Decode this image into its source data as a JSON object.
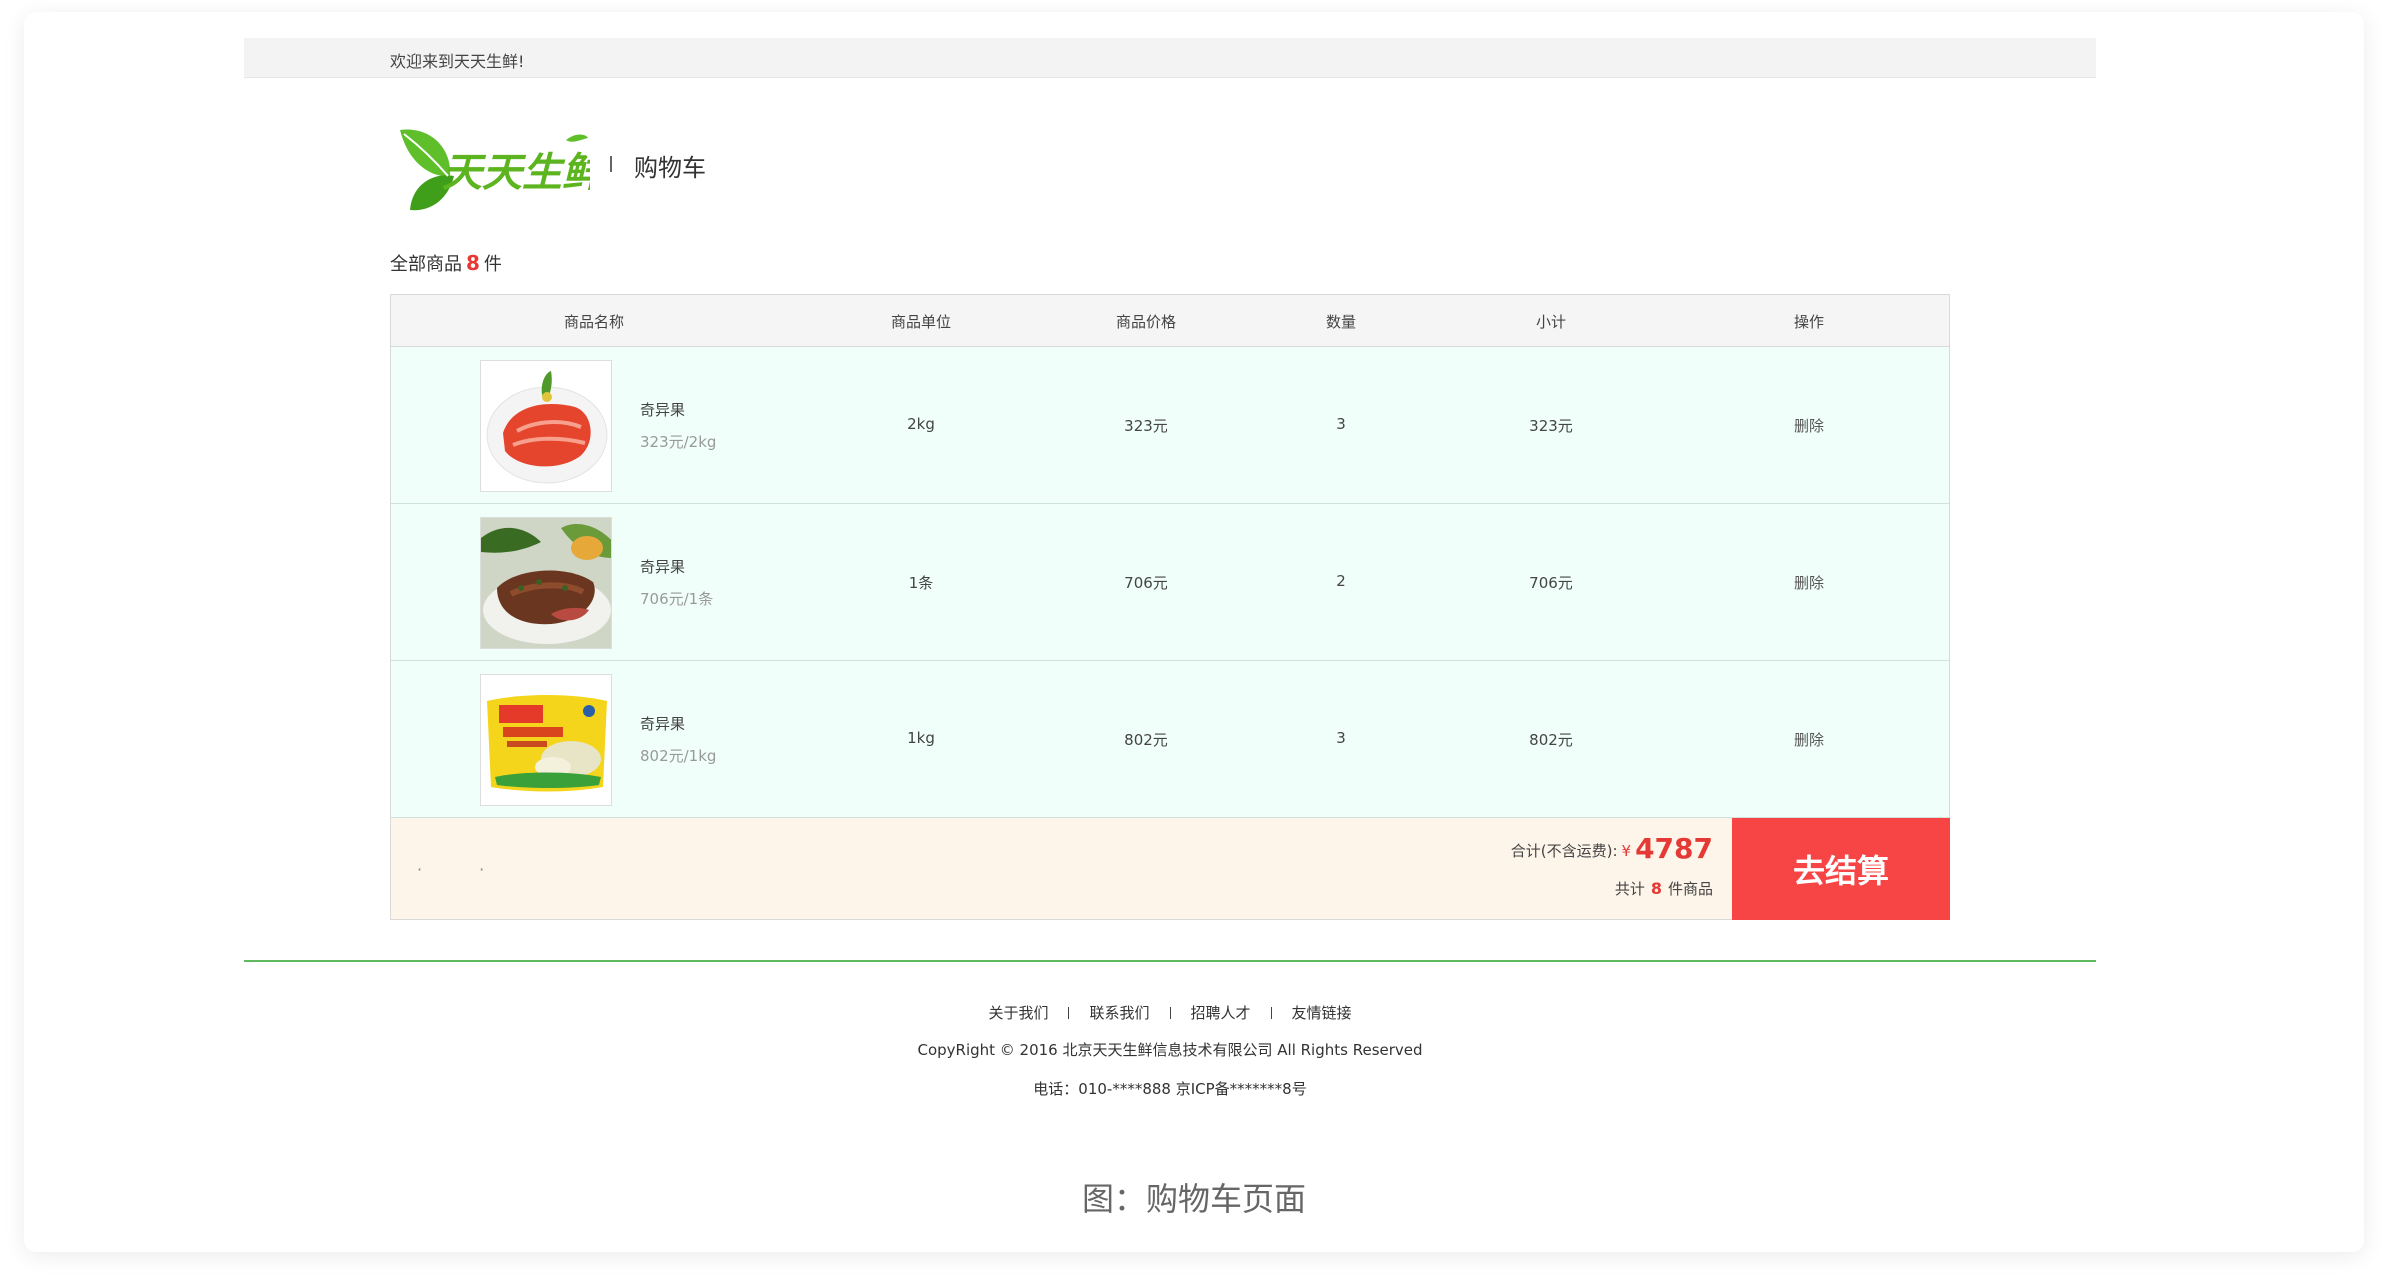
{
  "topbar": {
    "welcome": "欢迎来到天天生鲜!"
  },
  "header": {
    "logo_text": "天天生鲜",
    "page_title": "购物车"
  },
  "summary_count": {
    "prefix": "全部商品",
    "count": "8",
    "suffix": "件"
  },
  "table": {
    "columns": [
      "商品名称",
      "商品单位",
      "商品价格",
      "数量",
      "小计",
      "操作"
    ],
    "rows": [
      {
        "name": "奇异果",
        "unit_price": "323元/2kg",
        "unit": "2kg",
        "price": "323元",
        "qty": "3",
        "subtotal": "323元",
        "action": "删除",
        "image": "food-image-salmon"
      },
      {
        "name": "奇异果",
        "unit_price": "706元/1条",
        "unit": "1条",
        "price": "706元",
        "qty": "2",
        "subtotal": "706元",
        "action": "删除",
        "image": "food-image-steak"
      },
      {
        "name": "奇异果",
        "unit_price": "802元/1kg",
        "unit": "1kg",
        "price": "802元",
        "qty": "3",
        "subtotal": "802元",
        "action": "删除",
        "image": "food-image-dumplings-package"
      }
    ]
  },
  "totals": {
    "label": "合计(不含运费):",
    "currency": "¥",
    "amount": "4787",
    "qty_prefix": "共计",
    "qty": "8",
    "qty_suffix": "件商品",
    "checkout_label": "去结算",
    "dots": "· ·"
  },
  "footer": {
    "links": [
      "关于我们",
      "联系我们",
      "招聘人才",
      "友情链接"
    ],
    "copyright": "CopyRight © 2016 北京天天生鲜信息技术有限公司 All Rights Reserved",
    "phone": "电话：010-****888 京ICP备*******8号"
  },
  "caption": "图：购物车页面",
  "colors": {
    "accent_red": "#f74545",
    "row_bg": "#f0fffa",
    "summary_bg": "#fdf4ea",
    "footer_line": "#5fb95f",
    "logo_green": "#4caf1f"
  }
}
